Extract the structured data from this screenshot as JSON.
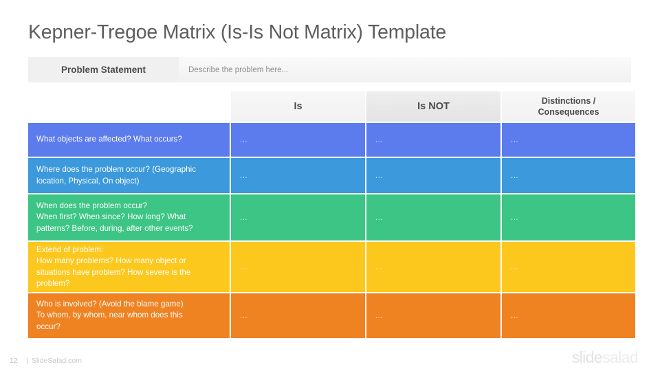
{
  "slide": {
    "title": "Kepner-Tregoe Matrix (Is-Is Not Matrix) Template"
  },
  "problem_statement": {
    "label": "Problem Statement",
    "value": "Describe the problem here..."
  },
  "matrix": {
    "headers": {
      "row_label": "",
      "is": "Is",
      "is_not": "Is NOT",
      "distinctions_line1": "Distinctions /",
      "distinctions_line2": "Consequences"
    },
    "rows": [
      {
        "color": "#5c7cee",
        "label_lines": [
          "What objects are affected? What occurs?"
        ],
        "is": "...",
        "is_not": "...",
        "distinctions": "..."
      },
      {
        "color": "#3b99dc",
        "label_lines": [
          "Where does the problem occur? (Geographic",
          "location, Physical, On object)"
        ],
        "is": "...",
        "is_not": "...",
        "distinctions": "..."
      },
      {
        "color": "#3cc584",
        "label_lines": [
          "When does the problem occur?",
          "When first? When since? How long? What",
          "patterns? Before, during, after other events?"
        ],
        "is": "...",
        "is_not": "...",
        "distinctions": "..."
      },
      {
        "color": "#fcc81e",
        "label_lines": [
          "Extend of problem:",
          "How many problems? How many object or",
          "situations have problem? How severe is the",
          "problem?"
        ],
        "is": "...",
        "is_not": "...",
        "distinctions": "..."
      },
      {
        "color": "#ef8221",
        "label_lines": [
          "Who is involved? (Avoid the blame game)",
          "To whom, by whom, near whom does this",
          "occur?"
        ],
        "is": "...",
        "is_not": "...",
        "distinctions": "..."
      }
    ]
  },
  "footer": {
    "page_number": "12",
    "separator": "|",
    "site": "SlideSalad.com",
    "logo_part1": "slide",
    "logo_part2": "salad"
  }
}
